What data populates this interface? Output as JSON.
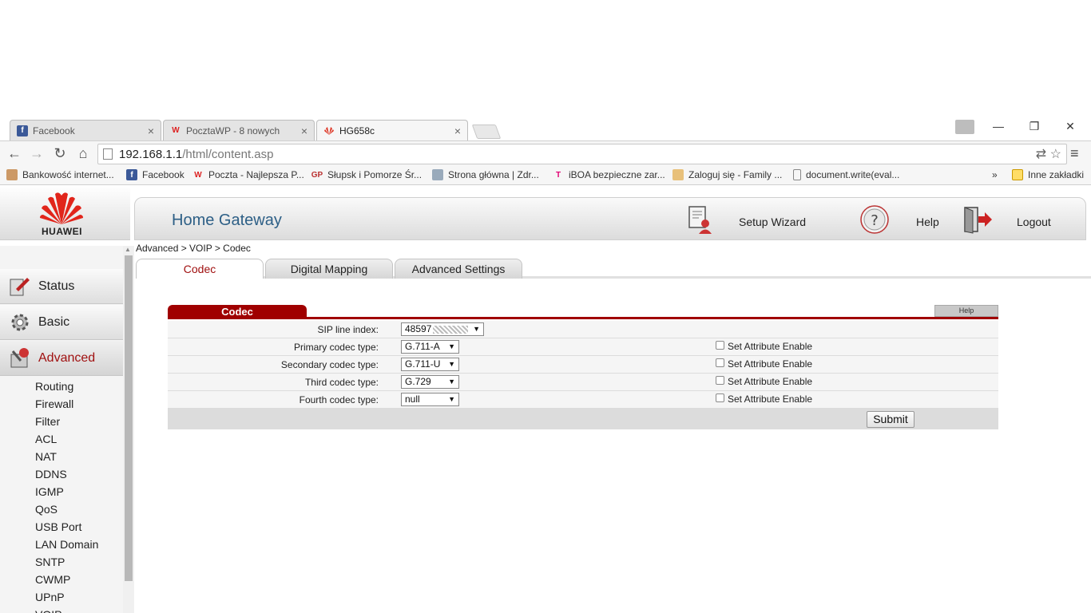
{
  "browser": {
    "tabs": [
      {
        "title": "Facebook"
      },
      {
        "title": "PocztaWP - 8 nowych"
      },
      {
        "title": "HG658c"
      }
    ],
    "url_host": "192.168.1.1",
    "url_path": "/html/content.asp",
    "bookmarks": [
      "Bankowość internet...",
      "Facebook",
      "Poczta - Najlepsza P...",
      "Słupsk i Pomorze Śr...",
      "Strona główna | Zdr...",
      "iBOA bezpieczne zar...",
      "Zaloguj się - Family ...",
      "document.write(eval...",
      "»",
      "Inne zakładki"
    ]
  },
  "header": {
    "logo": "HUAWEI",
    "title": "Home Gateway",
    "setup_wizard": "Setup Wizard",
    "help": "Help",
    "logout": "Logout"
  },
  "sidebar": {
    "main": [
      {
        "label": "Status"
      },
      {
        "label": "Basic"
      },
      {
        "label": "Advanced"
      }
    ],
    "sub": [
      "Routing",
      "Firewall",
      "Filter",
      "ACL",
      "NAT",
      "DDNS",
      "IGMP",
      "QoS",
      "USB Port",
      "LAN Domain",
      "SNTP",
      "CWMP",
      "UPnP",
      "VOIP"
    ]
  },
  "content": {
    "breadcrumb": "Advanced > VOIP > Codec",
    "tabs": [
      "Codec",
      "Digital Mapping",
      "Advanced Settings"
    ],
    "panel_title": "Codec",
    "help_tab": "Help",
    "sip_label": "SIP line index:",
    "sip_value": "48597",
    "rows": [
      {
        "label": "Primary codec type:",
        "value": "G.711-A",
        "check": "Set Attribute Enable"
      },
      {
        "label": "Secondary codec type:",
        "value": "G.711-U",
        "check": "Set Attribute Enable"
      },
      {
        "label": "Third codec type:",
        "value": "G.729",
        "check": "Set Attribute Enable"
      },
      {
        "label": "Fourth codec type:",
        "value": "null",
        "check": "Set Attribute Enable"
      }
    ],
    "submit": "Submit"
  }
}
